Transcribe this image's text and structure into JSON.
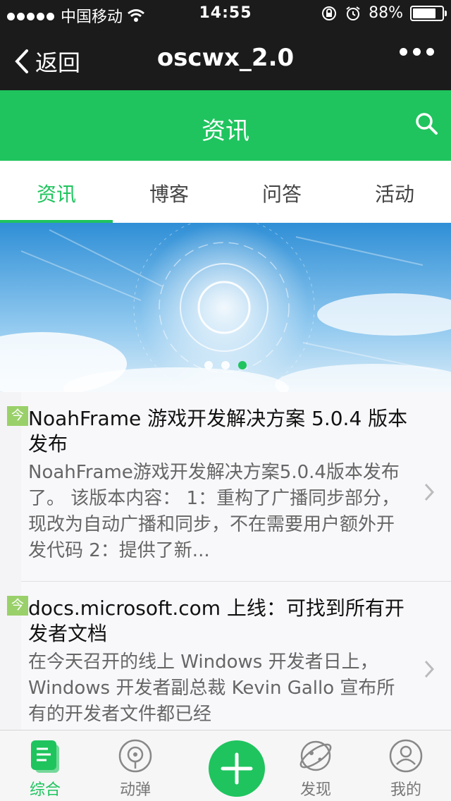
{
  "status_bar": {
    "carrier": "中国移动",
    "time": "14:55",
    "battery": "88%",
    "battery_level": 0.88
  },
  "nav": {
    "back_label": "返回",
    "title": "oscwx_2.0"
  },
  "app_header": {
    "title": "资讯"
  },
  "tabs": [
    {
      "label": "资讯",
      "active": true
    },
    {
      "label": "博客",
      "active": false
    },
    {
      "label": "问答",
      "active": false
    },
    {
      "label": "活动",
      "active": false
    }
  ],
  "banner": {
    "page_count": 3,
    "active_page": 3
  },
  "news": [
    {
      "tag": "今",
      "title": "NoahFrame 游戏开发解决方案 5.0.4 版本发布",
      "summary": "NoahFrame游戏开发解决方案5.0.4版本发布了。 该版本内容： 1：重构了广播同步部分，现改为自动广播和同步，不在需要用户额外开发代码 2：提供了新..."
    },
    {
      "tag": "今",
      "title": "docs.microsoft.com 上线：可找到所有开发者文档",
      "summary": "在今天召开的线上 Windows 开发者日上，Windows 开发者副总裁 Kevin Gallo 宣布所有的开发者文件都已经"
    }
  ],
  "bottom_tabs": [
    {
      "label": "综合",
      "icon": "document-icon",
      "active": true
    },
    {
      "label": "动弹",
      "icon": "speech-icon",
      "active": false
    },
    {
      "label": "",
      "icon": "plus-icon",
      "active": false
    },
    {
      "label": "发现",
      "icon": "planet-icon",
      "active": false
    },
    {
      "label": "我的",
      "icon": "user-icon",
      "active": false
    }
  ],
  "colors": {
    "accent": "#1fc45e",
    "nav_bg": "#1b1b1b"
  }
}
